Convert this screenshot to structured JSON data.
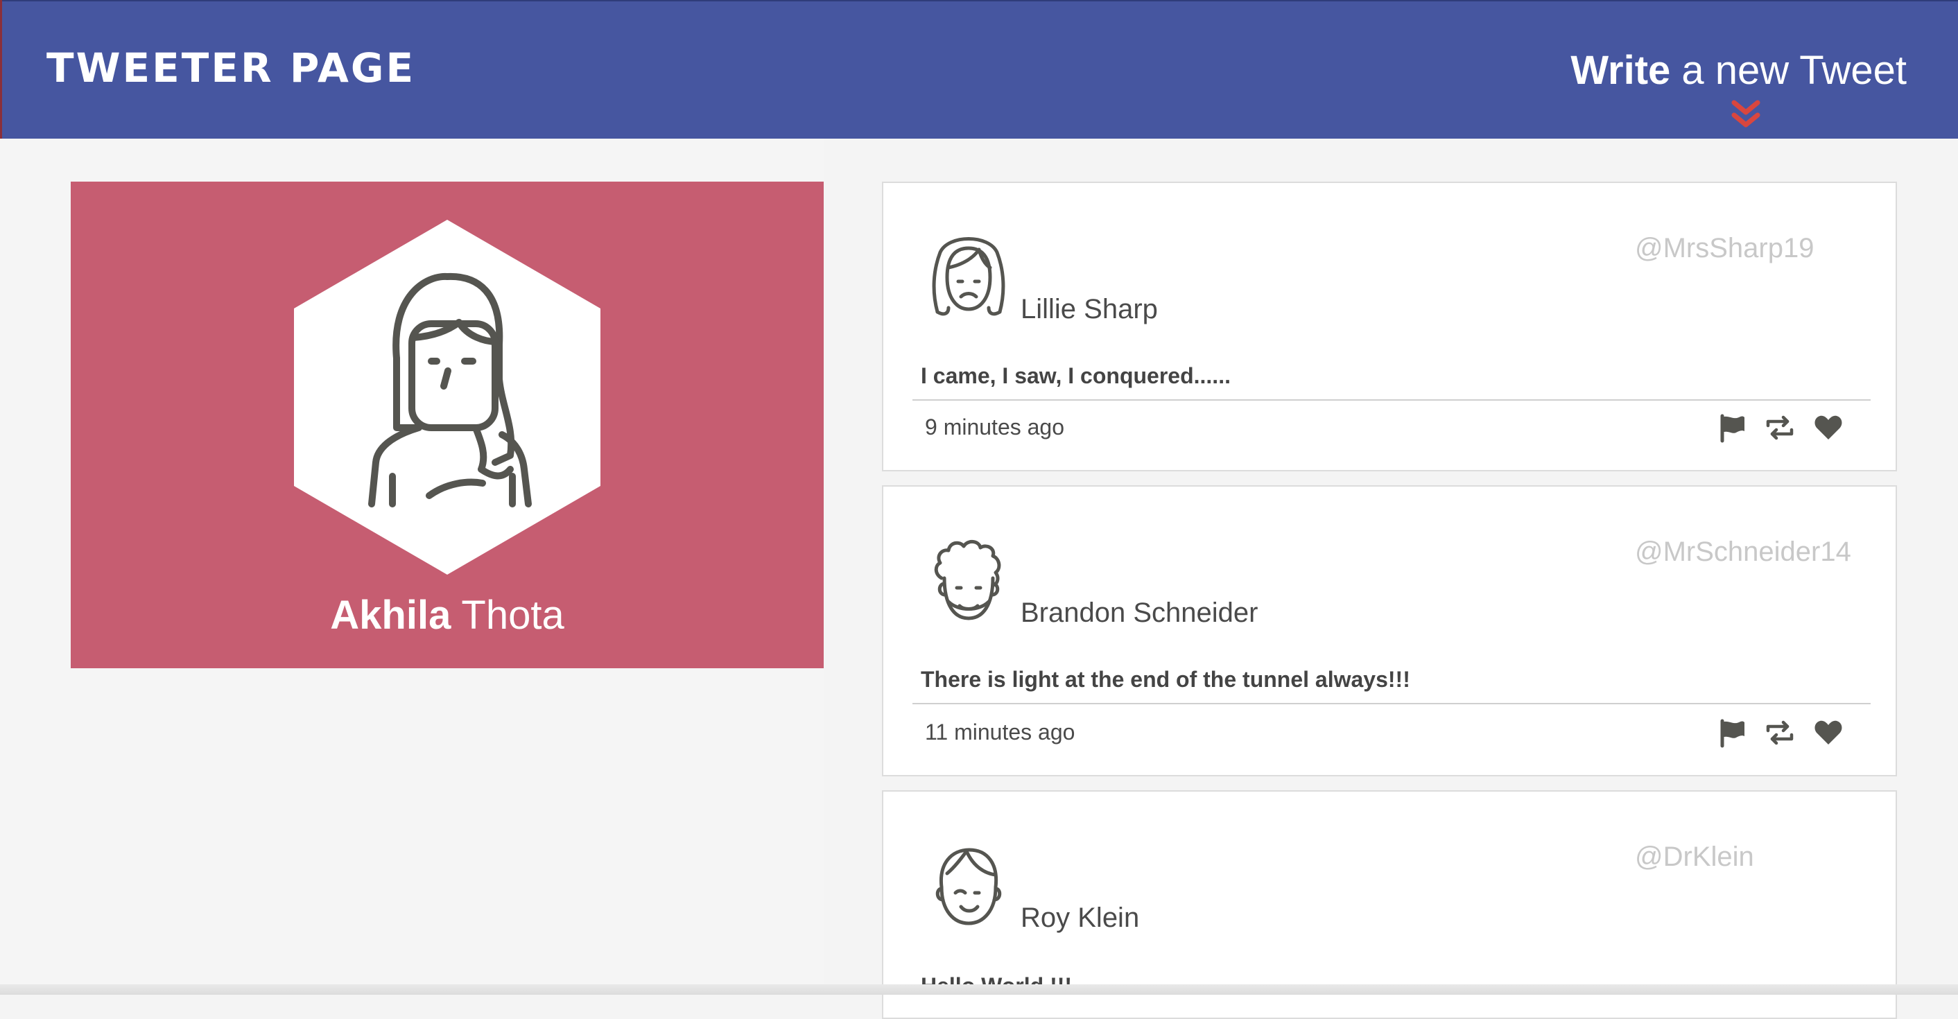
{
  "header": {
    "brand": "TWEETER PAGE",
    "compose_bold": "Write",
    "compose_rest": " a new Tweet",
    "compose_icon": "double-chevron-down-icon",
    "colors": {
      "navbar": "#4656a0",
      "chevron": "#d9463e"
    }
  },
  "profile": {
    "first_name": "Akhila",
    "last_name": " Thota",
    "avatar_icon": "woman-long-hair-avatar-icon",
    "colors": {
      "card": "#c65d71"
    }
  },
  "tweets": [
    {
      "name": "Lillie Sharp",
      "handle": "@MrsSharp19",
      "text": "I came, I saw, I conquered......",
      "time": "9 minutes ago",
      "avatar_icon": "sad-woman-avatar-icon"
    },
    {
      "name": "Brandon Schneider",
      "handle": "@MrSchneider14",
      "text": "There is light at the end of the tunnel always!!!",
      "time": "11 minutes ago",
      "avatar_icon": "curly-hair-man-avatar-icon"
    },
    {
      "name": "Roy Klein",
      "handle": "@DrKlein",
      "text": "Hello World !!!",
      "time": "",
      "avatar_icon": "winking-boy-avatar-icon"
    }
  ],
  "tweet_actions": [
    "flag-icon",
    "retweet-icon",
    "heart-icon"
  ]
}
